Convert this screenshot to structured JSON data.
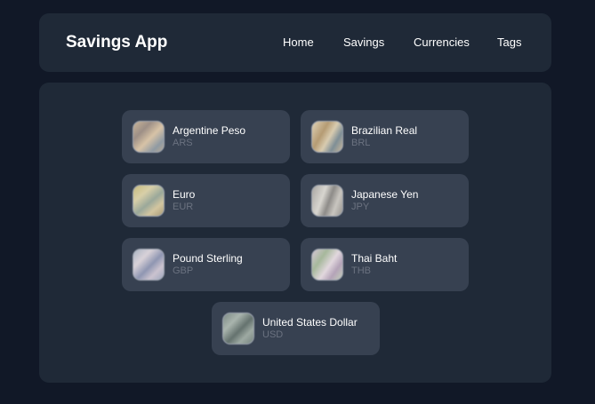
{
  "header": {
    "brand": "Savings App",
    "nav": [
      "Home",
      "Savings",
      "Currencies",
      "Tags"
    ]
  },
  "currencies": [
    {
      "name": "Argentine Peso",
      "code": "ARS",
      "icon": "ars-banknote-image"
    },
    {
      "name": "Brazilian Real",
      "code": "BRL",
      "icon": "brl-banknote-image"
    },
    {
      "name": "Euro",
      "code": "EUR",
      "icon": "eur-banknote-image"
    },
    {
      "name": "Japanese Yen",
      "code": "JPY",
      "icon": "jpy-banknote-image"
    },
    {
      "name": "Pound Sterling",
      "code": "GBP",
      "icon": "gbp-banknote-image"
    },
    {
      "name": "Thai Baht",
      "code": "THB",
      "icon": "thb-banknote-image"
    },
    {
      "name": "United States Dollar",
      "code": "USD",
      "icon": "usd-banknote-image"
    }
  ],
  "colors": {
    "page_bg": "#111827",
    "panel_bg": "#1f2937",
    "card_bg": "#374151",
    "text_primary": "#ffffff",
    "text_secondary": "#6b7280"
  }
}
